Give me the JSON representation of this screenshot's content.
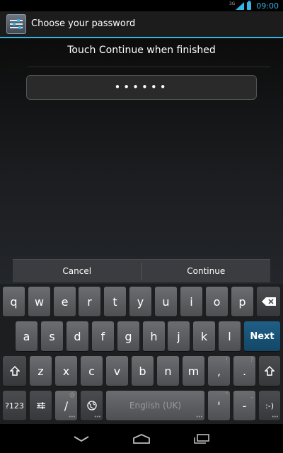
{
  "status_bar": {
    "network": "3G",
    "time": "09:00",
    "accent_color": "#33b5e5"
  },
  "action_bar": {
    "title": "Choose your password",
    "icon": "settings-sliders-icon"
  },
  "content": {
    "instruction": "Touch Continue when finished",
    "password_masked": "••••••"
  },
  "buttons": {
    "cancel": "Cancel",
    "continue": "Continue"
  },
  "keyboard": {
    "row1": [
      "q",
      "w",
      "e",
      "r",
      "t",
      "y",
      "u",
      "i",
      "o",
      "p"
    ],
    "row2": [
      "a",
      "s",
      "d",
      "f",
      "g",
      "h",
      "j",
      "k",
      "l"
    ],
    "row3": [
      "z",
      "x",
      "c",
      "v",
      "b",
      "n",
      "m",
      ",",
      "."
    ],
    "row3_hints": [
      "!",
      "?"
    ],
    "next_label": "Next",
    "symbols_label": "?123",
    "slash_label": "/",
    "slash_hint": "@",
    "space_label": "English (UK)",
    "apostrophe_label": "'",
    "apostrophe_hint": "\"",
    "dash_label": "-",
    "dash_hint": "_",
    "smiley_label": ":-)",
    "icons": {
      "delete": "backspace-icon",
      "shift": "shift-icon",
      "settings": "keyboard-settings-icon",
      "globe": "globe-icon"
    }
  },
  "nav_bar": {
    "back": "back-icon",
    "home": "home-icon",
    "recent": "recent-apps-icon"
  }
}
